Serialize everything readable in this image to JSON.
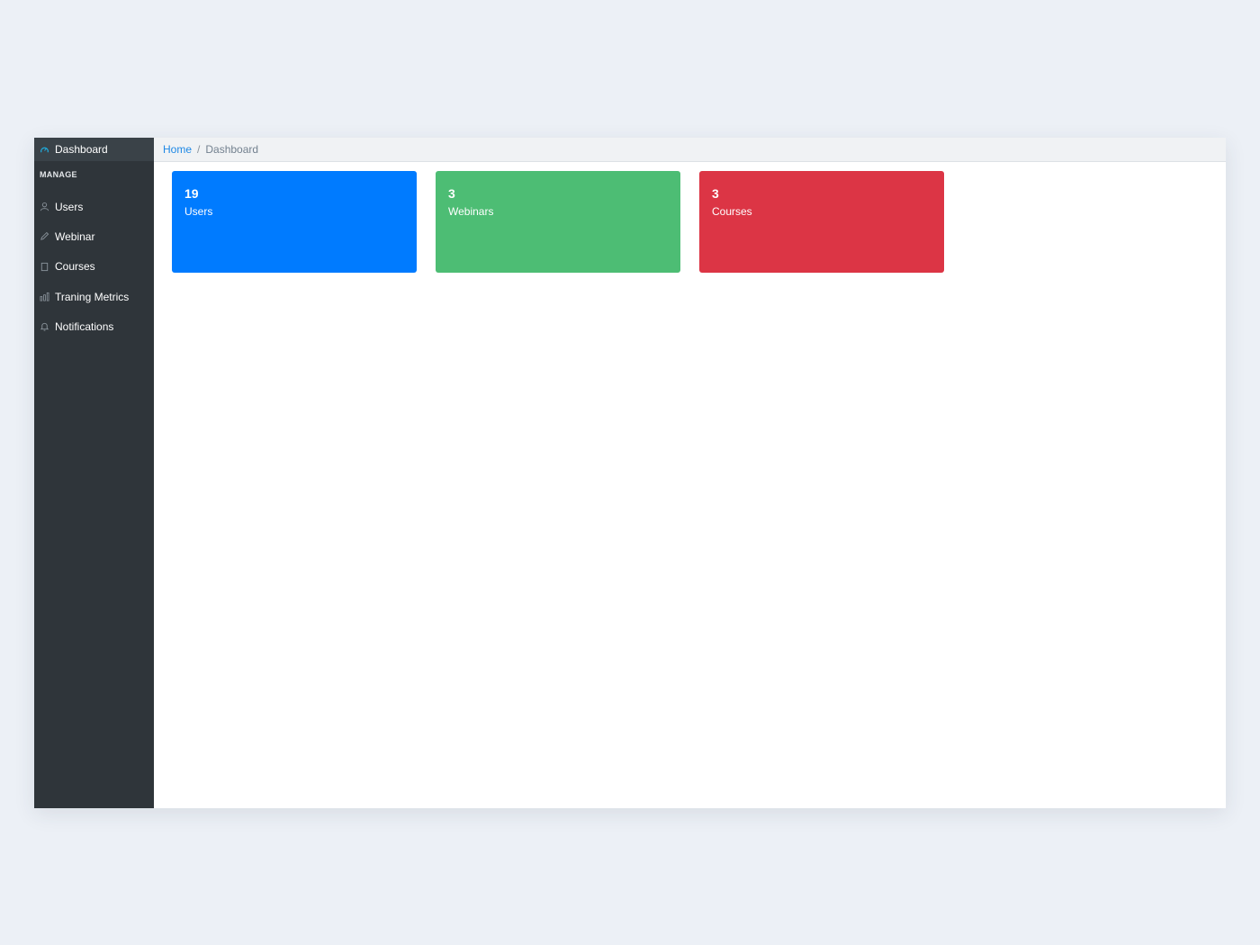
{
  "sidebar": {
    "top_item": {
      "label": "Dashboard",
      "icon": "speedometer-icon"
    },
    "section_title": "MANAGE",
    "items": [
      {
        "label": "Users",
        "icon": "user-icon"
      },
      {
        "label": "Webinar",
        "icon": "pencil-icon"
      },
      {
        "label": "Courses",
        "icon": "book-icon"
      },
      {
        "label": "Traning Metrics",
        "icon": "bar-chart-icon"
      },
      {
        "label": "Notifications",
        "icon": "bell-icon"
      }
    ]
  },
  "breadcrumb": {
    "home": "Home",
    "separator": "/",
    "current": "Dashboard"
  },
  "cards": [
    {
      "value": "19",
      "label": "Users",
      "color": "#007bff"
    },
    {
      "value": "3",
      "label": "Webinars",
      "color": "#4dbd74"
    },
    {
      "value": "3",
      "label": "Courses",
      "color": "#dc3545"
    }
  ],
  "colors": {
    "sidebar_bg": "#2f353a",
    "active_icon": "#20a8d8",
    "link": "#1e88e5",
    "page_bg": "#ecf0f6"
  }
}
